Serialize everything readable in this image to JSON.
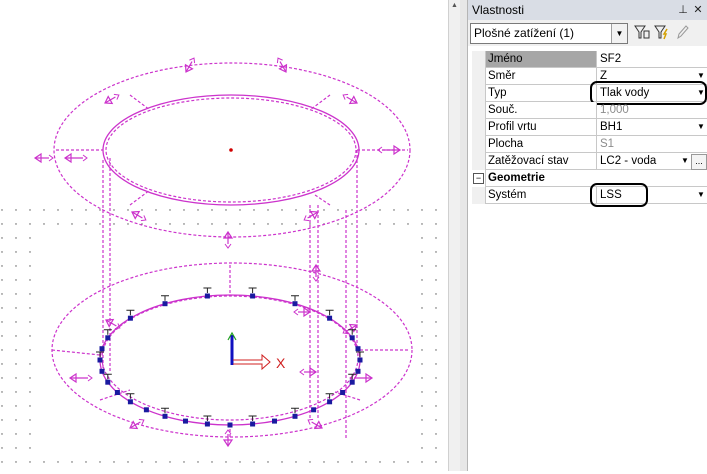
{
  "panel": {
    "title": "Vlastnosti",
    "pin_icon": "pin-icon",
    "close_icon": "close-icon",
    "selector_value": "Plošné zatížení (1)",
    "toolbar_icons": [
      "filter-select-icon",
      "filter-lightning-icon",
      "pencil-icon"
    ]
  },
  "properties": [
    {
      "label": "Jméno",
      "value": "SF2",
      "selected": true
    },
    {
      "label": "Směr",
      "value": "Z",
      "dropdown": true
    },
    {
      "label": "Typ",
      "value": "Tlak vody",
      "dropdown": true,
      "highlighted": true
    },
    {
      "label": "Souč.",
      "value": "1,000",
      "grey": true
    },
    {
      "label": "Profil vrtu",
      "value": "BH1",
      "dropdown": true
    },
    {
      "label": "Plocha",
      "value": "S1",
      "grey": true
    },
    {
      "label": "Zatěžovací stav",
      "value": "LC2 - voda",
      "dropdown": true,
      "ellipsis": "..."
    }
  ],
  "group": {
    "label": "Geometrie",
    "expander": "⊟"
  },
  "group_properties": [
    {
      "label": "Systém",
      "value": "LSS",
      "dropdown": true,
      "highlighted": true
    }
  ],
  "viewport": {
    "model": "cylindrical tank with surface water pressure load",
    "axis_label_x": "X",
    "load_color": "#cc33cc",
    "support_color": "#1a1aa0"
  }
}
